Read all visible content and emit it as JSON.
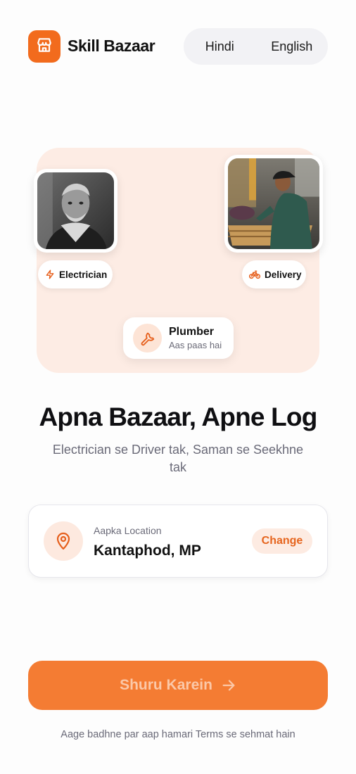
{
  "header": {
    "app_title": "Skill Bazaar",
    "logo_icon": "storefront-icon",
    "languages": [
      "Hindi",
      "English"
    ]
  },
  "hero": {
    "tags": [
      {
        "label": "Electrician",
        "icon": "lightning-icon"
      },
      {
        "label": "Delivery",
        "icon": "bicycle-icon"
      }
    ],
    "service_card": {
      "title": "Plumber",
      "subtitle": "Aas paas hai",
      "icon": "wrench-icon"
    }
  },
  "main": {
    "headline": "Apna Bazaar, Apne Log",
    "subline": "Electrician se Driver tak, Saman se Seekhne tak"
  },
  "location": {
    "label": "Aapka Location",
    "value": "Kantaphod, MP",
    "change_label": "Change",
    "icon": "map-pin-icon"
  },
  "cta": {
    "label": "Shuru Karein",
    "icon": "arrow-right-icon"
  },
  "footer": {
    "terms": "Aage badhne par aap hamari Terms se sehmat hain"
  },
  "colors": {
    "accent": "#f26b1d",
    "hero_bg": "#fdece4",
    "cta_bg": "#f47c33"
  }
}
